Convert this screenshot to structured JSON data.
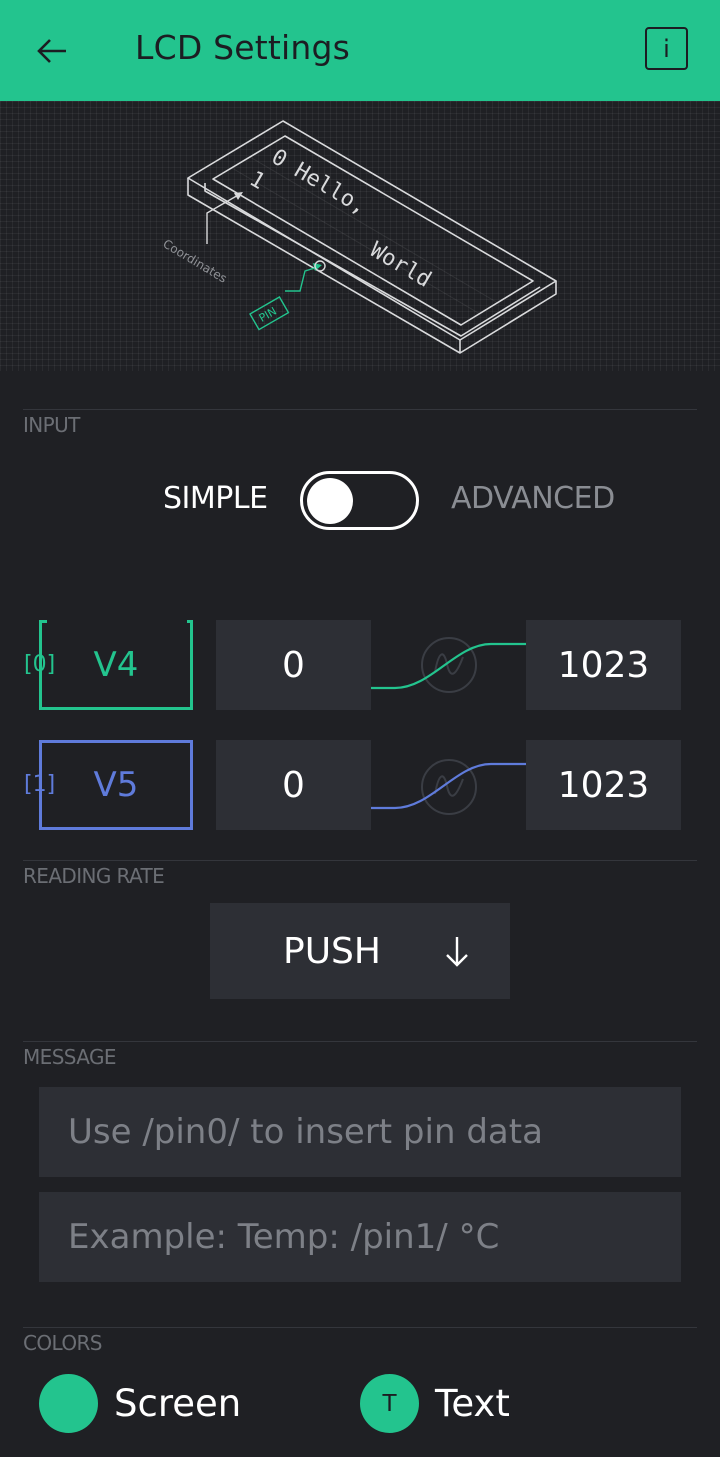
{
  "header": {
    "title": "LCD Settings"
  },
  "preview": {
    "row0_text": "0 Hello,",
    "row1_index": "1",
    "row1_text": "World",
    "coordinates_label": "Coordinates",
    "pin_label": "PIN"
  },
  "input": {
    "section_label": "INPUT",
    "mode_simple": "SIMPLE",
    "mode_advanced": "ADVANCED",
    "mode_advanced_selected": false,
    "pins": [
      {
        "index": "[0]",
        "pin": "V4",
        "min": "0",
        "max": "1023",
        "color": "#23c48e"
      },
      {
        "index": "[1]",
        "pin": "V5",
        "min": "0",
        "max": "1023",
        "color": "#5f7bdb"
      }
    ]
  },
  "reading_rate": {
    "section_label": "READING RATE",
    "value": "PUSH"
  },
  "message": {
    "section_label": "MESSAGE",
    "line1_placeholder": "Use /pin0/ to insert pin data",
    "line2_placeholder": "Example: Temp: /pin1/ °C"
  },
  "colors": {
    "section_label": "COLORS",
    "screen_label": "Screen",
    "text_label": "Text",
    "text_dot_letter": "T",
    "screen_color": "#23c48e",
    "text_color": "#23c48e"
  },
  "theme": {
    "accent": "#23c48e",
    "pin2_color": "#5f7bdb",
    "background": "#1f2024"
  }
}
